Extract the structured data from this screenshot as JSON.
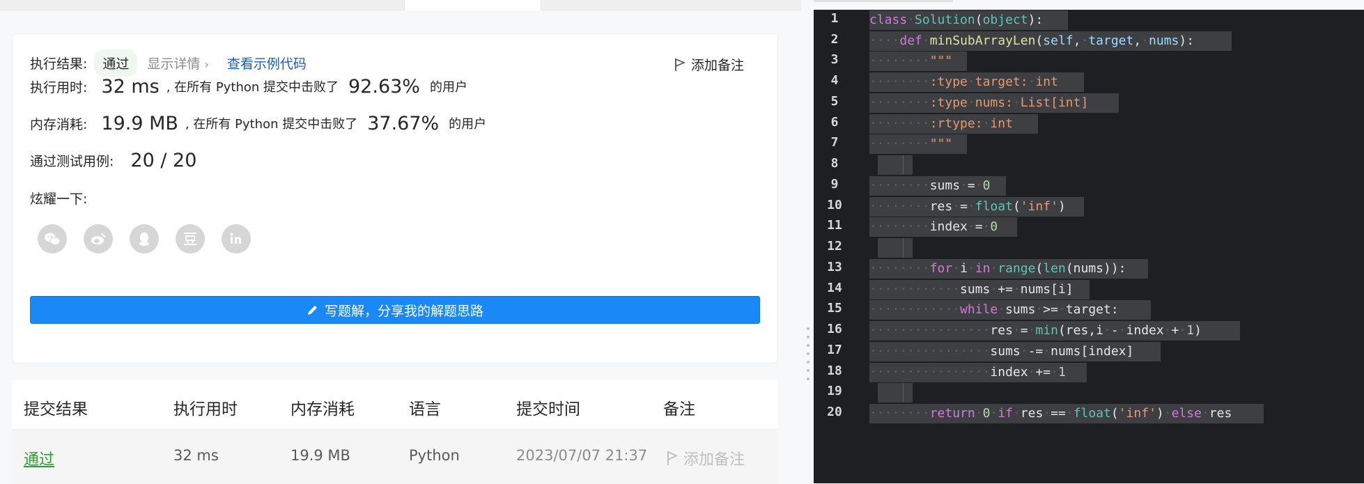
{
  "result_card": {
    "exec_result_label": "执行结果:",
    "pass_badge": "通过",
    "show_details": "显示详情",
    "view_sample_code": "查看示例代码",
    "add_note": "添加备注",
    "runtime_label": "执行用时:",
    "runtime_value": "32 ms",
    "runtime_mid": ", 在所有 Python 提交中击败了",
    "runtime_pct": "92.63%",
    "runtime_tail": "的用户",
    "memory_label": "内存消耗:",
    "memory_value": "19.9 MB",
    "memory_mid": ", 在所有 Python 提交中击败了",
    "memory_pct": "37.67%",
    "memory_tail": "的用户",
    "testcases_label": "通过测试用例:",
    "testcases_value": "20 / 20",
    "share_label": "炫耀一下:",
    "share_icons": [
      "wechat-icon",
      "weibo-icon",
      "qq-icon",
      "douban-icon",
      "linkedin-icon"
    ],
    "write_solution": "写题解，分享我的解题思路"
  },
  "submissions": {
    "headers": [
      "提交结果",
      "执行用时",
      "内存消耗",
      "语言",
      "提交时间",
      "备注"
    ],
    "rows": [
      {
        "result": "通过",
        "runtime": "32 ms",
        "memory": "19.9 MB",
        "language": "Python",
        "time": "2023/07/07 21:37",
        "note": "添加备注"
      }
    ]
  },
  "editor": {
    "line_numbers": [
      "1",
      "2",
      "3",
      "4",
      "5",
      "6",
      "7",
      "8",
      "9",
      "10",
      "11",
      "12",
      "13",
      "14",
      "15",
      "16",
      "17",
      "18",
      "19",
      "20"
    ]
  },
  "colors": {
    "accent": "#1a89f5",
    "pass_green": "#2ca02c",
    "editor_bg": "#1e1f22"
  }
}
